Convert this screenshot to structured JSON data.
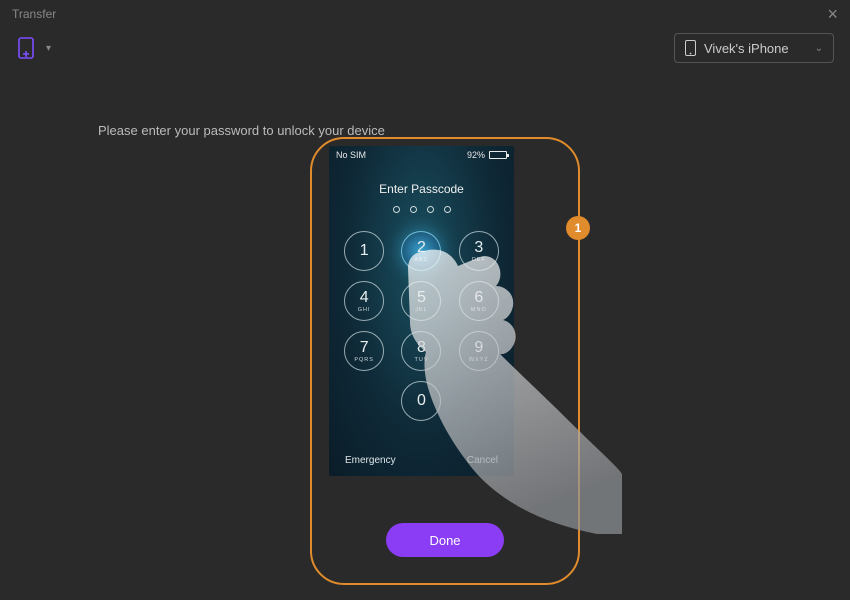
{
  "window": {
    "title": "Transfer"
  },
  "toolbar": {
    "device_name": "Vivek's iPhone"
  },
  "instruction": "Please enter your password to unlock your device",
  "step_badge": "1",
  "phone": {
    "status": {
      "left": "No SIM",
      "battery_pct": "92%"
    },
    "passcode_title": "Enter Passcode",
    "keys": [
      {
        "num": "1",
        "sub": ""
      },
      {
        "num": "2",
        "sub": "ABC"
      },
      {
        "num": "3",
        "sub": "DEF"
      },
      {
        "num": "4",
        "sub": "GHI"
      },
      {
        "num": "5",
        "sub": "JKL"
      },
      {
        "num": "6",
        "sub": "MNO"
      },
      {
        "num": "7",
        "sub": "PQRS"
      },
      {
        "num": "8",
        "sub": "TUV"
      },
      {
        "num": "9",
        "sub": "WXYZ"
      },
      {
        "num": "0",
        "sub": ""
      }
    ],
    "bottom": {
      "left": "Emergency",
      "right": "Cancel"
    }
  },
  "done_label": "Done"
}
